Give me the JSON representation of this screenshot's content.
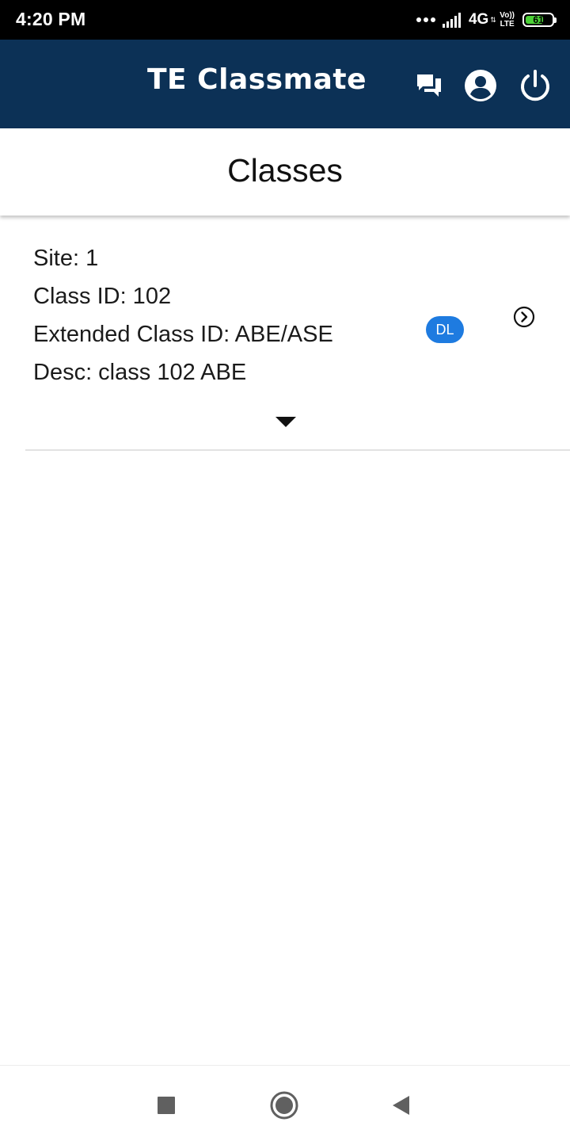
{
  "status_bar": {
    "time": "4:20 PM",
    "network": "4G",
    "network_arrows": "⇅",
    "volte_top": "Vo))",
    "volte_bottom": "LTE",
    "battery_level": "61",
    "battery_color": "#4cd137"
  },
  "app_bar": {
    "title": "TE Classmate",
    "background": "#0c3156",
    "icons": [
      "chat-icon",
      "account-circle-icon",
      "power-icon"
    ]
  },
  "page": {
    "title": "Classes"
  },
  "classes": [
    {
      "site": "Site: 1",
      "class_id": "Class ID: 102",
      "extended_class_id": "Extended Class ID: ABE/ASE",
      "desc": "Desc: class 102 ABE",
      "badge": "DL",
      "badge_color": "#1e7be0",
      "actions": [
        "chevron-right-circle-icon",
        "expand-arrow-icon"
      ]
    }
  ],
  "nav_bar": {
    "icons": [
      "recents-icon",
      "home-icon",
      "back-icon"
    ]
  }
}
